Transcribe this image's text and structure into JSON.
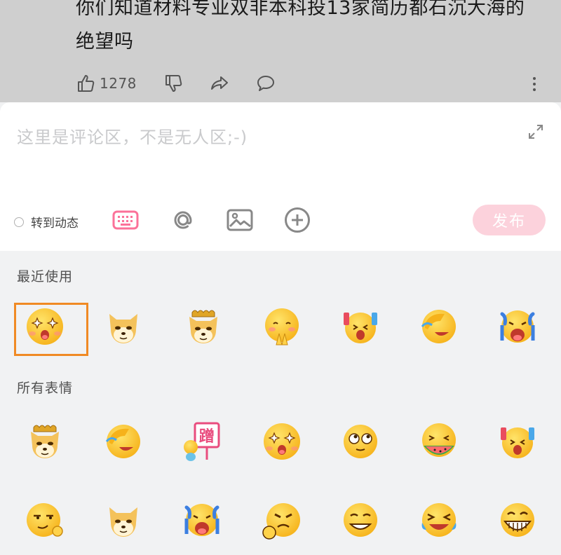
{
  "post": {
    "title": "你们知道材料专业双非本科投13家简历都石沉大海的绝望吗",
    "like_count": "1278"
  },
  "editor": {
    "placeholder": "这里是评论区，不是无人区;-)",
    "repost_label": "转到动态",
    "publish_label": "发布"
  },
  "emoji_panel": {
    "recent_label": "最近使用",
    "all_label": "所有表情",
    "recent": [
      "starry-eyes-emoji",
      "doge-emoji",
      "doge-crown-emoji",
      "shy-hands-emoji",
      "cheer-sticks-emoji",
      "cover-face-laugh-emoji",
      "crying-loud-emoji"
    ],
    "all_row1": [
      "doge-crown-emoji",
      "cover-face-laugh-emoji",
      "rub-sign-emoji",
      "starry-eyes-emoji",
      "rolling-eyes-emoji",
      "watermelon-emoji",
      "cheer-sticks-emoji"
    ],
    "all_row2": [
      "smug-ok-emoji",
      "doge-emoji",
      "crying-loud-emoji",
      "angry-fist-emoji",
      "grin-emoji",
      "laugh-tears-emoji",
      "big-grin-emoji"
    ],
    "sticker_sign_text": "蹭"
  },
  "colors": {
    "accent_pink": "#fb7299",
    "publish_disabled": "#fcd2dc",
    "selection_orange": "#f08a24",
    "emoji_yellow": "#ffcf3a"
  }
}
